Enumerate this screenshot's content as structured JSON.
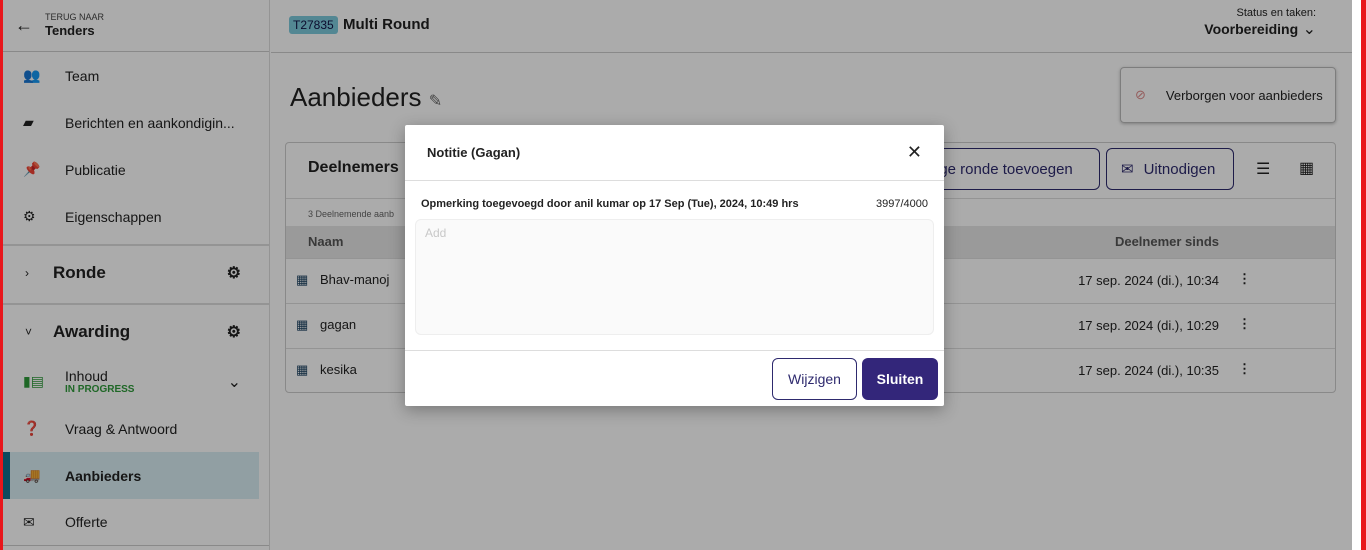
{
  "sidebar": {
    "back_label": "TERUG NAAR",
    "back_target": "Tenders",
    "items": [
      {
        "label": "Team",
        "icon": "people-icon"
      },
      {
        "label": "Berichten en aankondigin...",
        "icon": "message-icon"
      },
      {
        "label": "Publicatie",
        "icon": "pin-icon"
      },
      {
        "label": "Eigenschappen",
        "icon": "gear-icon"
      }
    ],
    "sections": [
      {
        "label": "Ronde"
      },
      {
        "label": "Awarding"
      }
    ],
    "awarding_items": [
      {
        "label": "Inhoud",
        "status": "IN PROGRESS"
      },
      {
        "label": "Vraag & Antwoord"
      },
      {
        "label": "Aanbieders"
      },
      {
        "label": "Offerte"
      }
    ]
  },
  "header": {
    "badge": "T27835",
    "title": "Multi Round",
    "status_label": "Status en taken:",
    "status_value": "Voorbereiding"
  },
  "page": {
    "title": "Aanbieders",
    "visibility": "Verborgen voor aanbieders"
  },
  "card": {
    "title": "Deelnemers",
    "add_round_button": "rige ronde toevoegen",
    "invite_button": "Uitnodigen",
    "count_text": "3  Deelnemende aanb",
    "columns": [
      "Naam",
      "Deelnemer sinds"
    ],
    "rows": [
      {
        "name": "Bhav-manoj",
        "since": "17 sep. 2024 (di.), 10:34"
      },
      {
        "name": "gagan",
        "since": "17 sep. 2024 (di.), 10:29"
      },
      {
        "name": "kesika",
        "since": "17 sep. 2024 (di.), 10:35"
      }
    ]
  },
  "modal": {
    "title": "Notitie (Gagan)",
    "meta": "Opmerking toegevoegd door anil kumar op 17 Sep (Tue), 2024, 10:49 hrs",
    "counter": "3997/4000",
    "placeholder": "Add",
    "edit_button": "Wijzigen",
    "close_button": "Sluiten"
  },
  "colors": {
    "primary": "#33267a",
    "accent": "#126f8c",
    "status_green": "#2e9a3a",
    "frame": "#e8161b"
  }
}
